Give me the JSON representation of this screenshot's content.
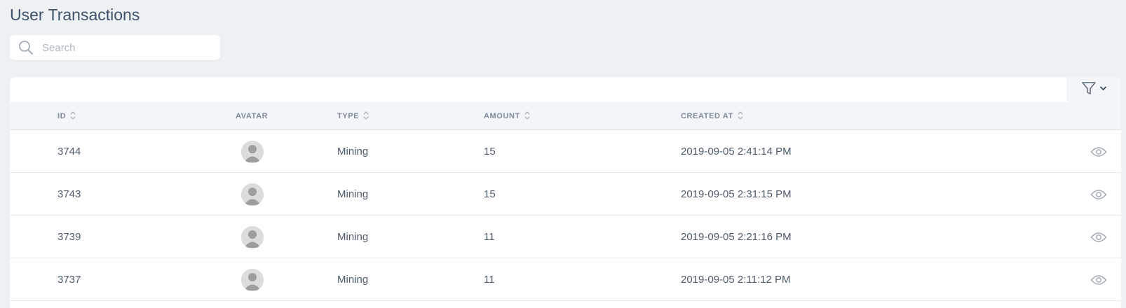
{
  "page": {
    "title": "User Transactions"
  },
  "search": {
    "placeholder": "Search",
    "value": ""
  },
  "toolbar": {
    "filter_icon": "filter-icon",
    "dropdown_icon": "chevron-down-icon"
  },
  "table": {
    "columns": [
      {
        "key": "id",
        "label": "ID",
        "sortable": true
      },
      {
        "key": "avatar",
        "label": "AVATAR",
        "sortable": false
      },
      {
        "key": "type",
        "label": "TYPE",
        "sortable": true
      },
      {
        "key": "amount",
        "label": "AMOUNT",
        "sortable": true
      },
      {
        "key": "created_at",
        "label": "CREATED AT",
        "sortable": true
      }
    ],
    "rows": [
      {
        "id": "3744",
        "type": "Mining",
        "amount": "15",
        "created_at": "2019-09-05 2:41:14 PM"
      },
      {
        "id": "3743",
        "type": "Mining",
        "amount": "15",
        "created_at": "2019-09-05 2:31:15 PM"
      },
      {
        "id": "3739",
        "type": "Mining",
        "amount": "11",
        "created_at": "2019-09-05 2:21:16 PM"
      },
      {
        "id": "3737",
        "type": "Mining",
        "amount": "11",
        "created_at": "2019-09-05 2:11:12 PM"
      }
    ],
    "row_action_icon": "eye-icon"
  },
  "colors": {
    "background": "#eef1f4",
    "header_bg": "#f3f6f9",
    "text": "#4d5b6b",
    "muted": "#7f8b98"
  }
}
